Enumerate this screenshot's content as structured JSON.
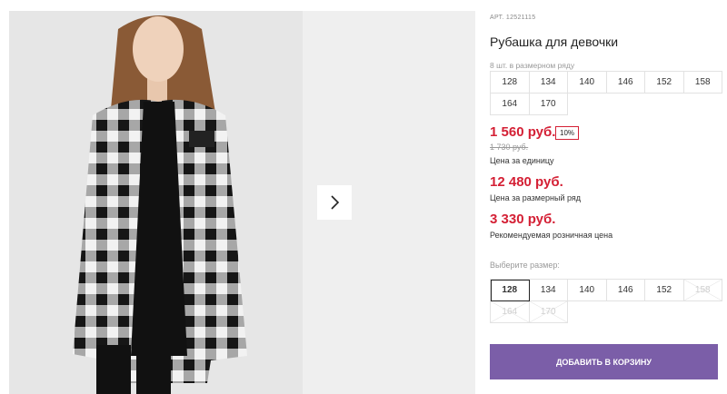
{
  "product": {
    "article": "АРТ. 12521115",
    "title": "Рубашка для девочки",
    "image_alt": "Рубашка для девочки"
  },
  "pack": {
    "label": "8 шт. в размерном ряду",
    "sizes": [
      "128",
      "134",
      "140",
      "146",
      "152",
      "158",
      "164",
      "170"
    ]
  },
  "pricing": {
    "unit_price": "1 560 руб.",
    "discount": "10%",
    "old_price": "1 730 руб.",
    "unit_caption": "Цена за единицу",
    "pack_price": "12 480 руб.",
    "pack_caption": "Цена за размерный ряд",
    "retail_price": "3 330 руб.",
    "retail_caption": "Рекомендуемая розничная цена",
    "accent_color": "#d42035"
  },
  "size_selector": {
    "label": "Выберите размер:",
    "options": [
      {
        "size": "128",
        "state": "selected"
      },
      {
        "size": "134",
        "state": "available"
      },
      {
        "size": "140",
        "state": "available"
      },
      {
        "size": "146",
        "state": "available"
      },
      {
        "size": "152",
        "state": "available"
      },
      {
        "size": "158",
        "state": "disabled"
      },
      {
        "size": "164",
        "state": "disabled"
      },
      {
        "size": "170",
        "state": "disabled"
      }
    ]
  },
  "cart": {
    "add_label": "ДОБАВИТЬ В КОРЗИНУ",
    "button_color": "#7b5ea8"
  },
  "gallery": {
    "next_icon": "chevron-right-icon"
  }
}
